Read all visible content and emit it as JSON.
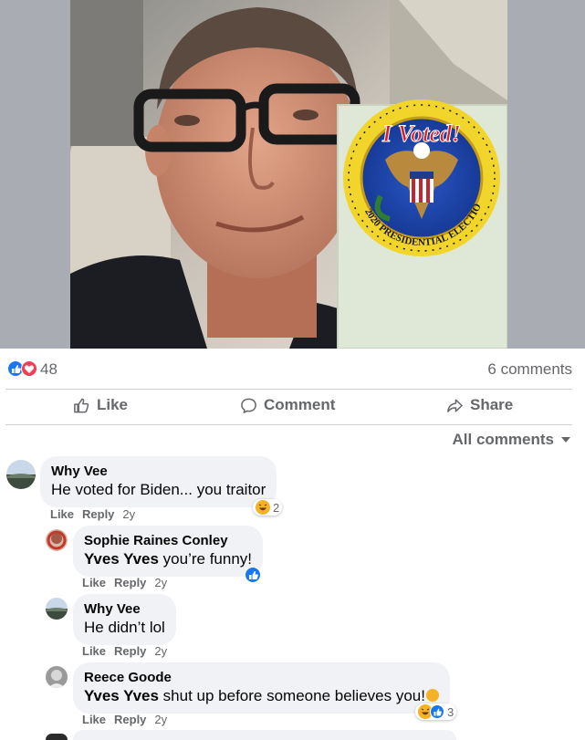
{
  "post": {
    "sticker": {
      "top_text": "I Voted!",
      "ring_text": "2020 PRESIDENTIAL ELECTION"
    },
    "reaction_count": "48",
    "comments_count": "6 comments",
    "actions": {
      "like": "Like",
      "comment": "Comment",
      "share": "Share"
    },
    "all_comments_label": "All comments"
  },
  "comments": [
    {
      "author": "Why Vee",
      "mention": "",
      "text": "He voted for Biden... you traitor",
      "like": "Like",
      "reply": "Reply",
      "time": "2y",
      "reaction_count": "2"
    },
    {
      "author": "Sophie Raines Conley",
      "mention": "Yves Yves",
      "text": " you’re funny!",
      "like": "Like",
      "reply": "Reply",
      "time": "2y"
    },
    {
      "author": "Why Vee",
      "mention": "",
      "text": "He didn’t lol",
      "like": "Like",
      "reply": "Reply",
      "time": "2y"
    },
    {
      "author": "Reece Goode",
      "mention": "Yves Yves",
      "text": " shut up before someone believes you!",
      "like": "Like",
      "reply": "Reply",
      "time": "2y",
      "reaction_count": "3"
    }
  ],
  "colors": {
    "like_blue": "#1877f2",
    "love_red": "#f33e58",
    "haha_yellow": "#f7b125",
    "secondary_text": "#65676b",
    "bubble": "#f0f2f5"
  }
}
